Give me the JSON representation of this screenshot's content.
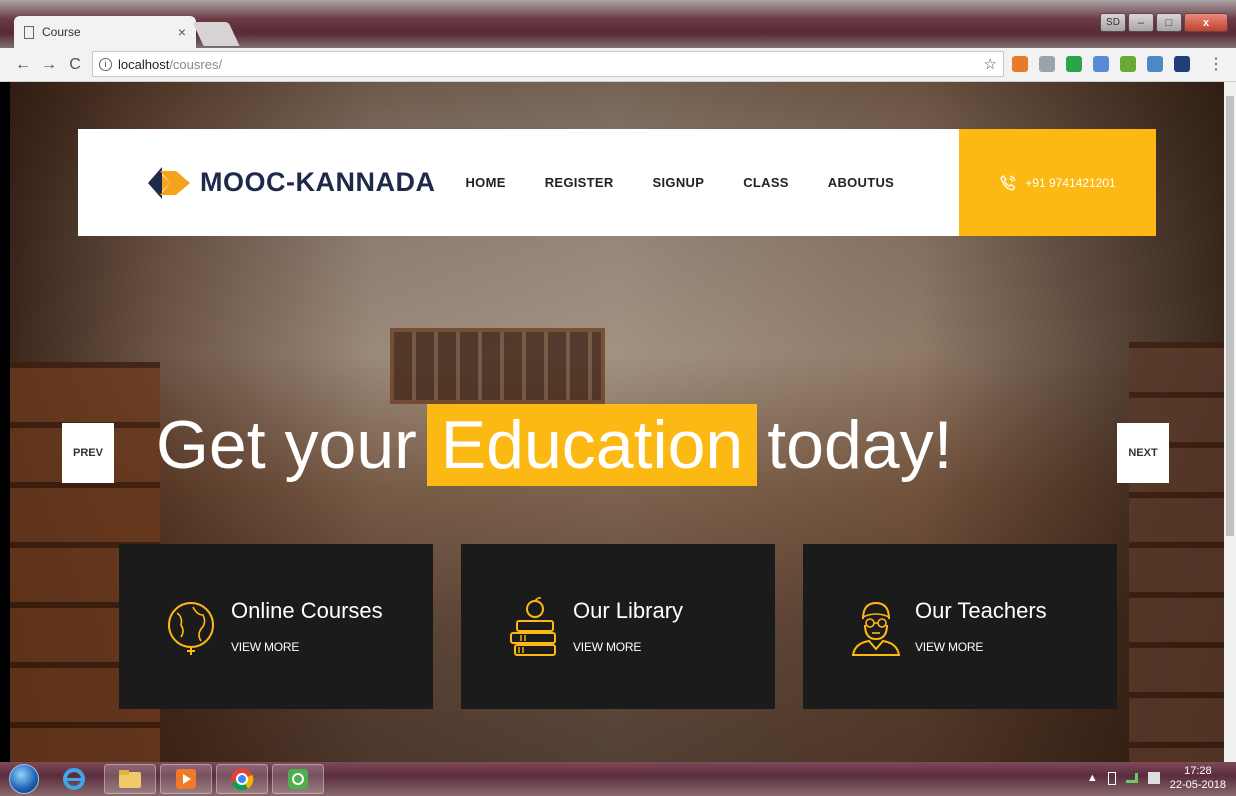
{
  "browser": {
    "tab_title": "Course",
    "tab_close": "×",
    "url_host": "localhost",
    "url_path": "/cousres/",
    "window_sd": "SD",
    "window_min": "–",
    "window_max": "□",
    "window_close": "x",
    "nav_back": "←",
    "nav_forward": "→",
    "nav_reload": "C",
    "info": "i",
    "star": "☆",
    "menu": "⋮"
  },
  "site": {
    "logo_text": "MOOC-KANNADA",
    "nav": [
      "HOME",
      "REGISTER",
      "SIGNUP",
      "CLASS",
      "ABOUTUS"
    ],
    "phone": "+91 9741421201",
    "hero_before": "Get your",
    "hero_highlight": "Education",
    "hero_after": "today!",
    "prev": "PREV",
    "next": "NEXT",
    "cards": [
      {
        "title": "Online Courses",
        "link": "VIEW MORE"
      },
      {
        "title": "Our Library",
        "link": "VIEW MORE"
      },
      {
        "title": "Our Teachers",
        "link": "VIEW MORE"
      }
    ],
    "colors": {
      "accent": "#fdb913",
      "logo": "#1d2a4a",
      "card_bg": "#1b1b1b"
    }
  },
  "taskbar": {
    "time": "17:28",
    "date": "22-05-2018",
    "tray_up": "▲"
  }
}
